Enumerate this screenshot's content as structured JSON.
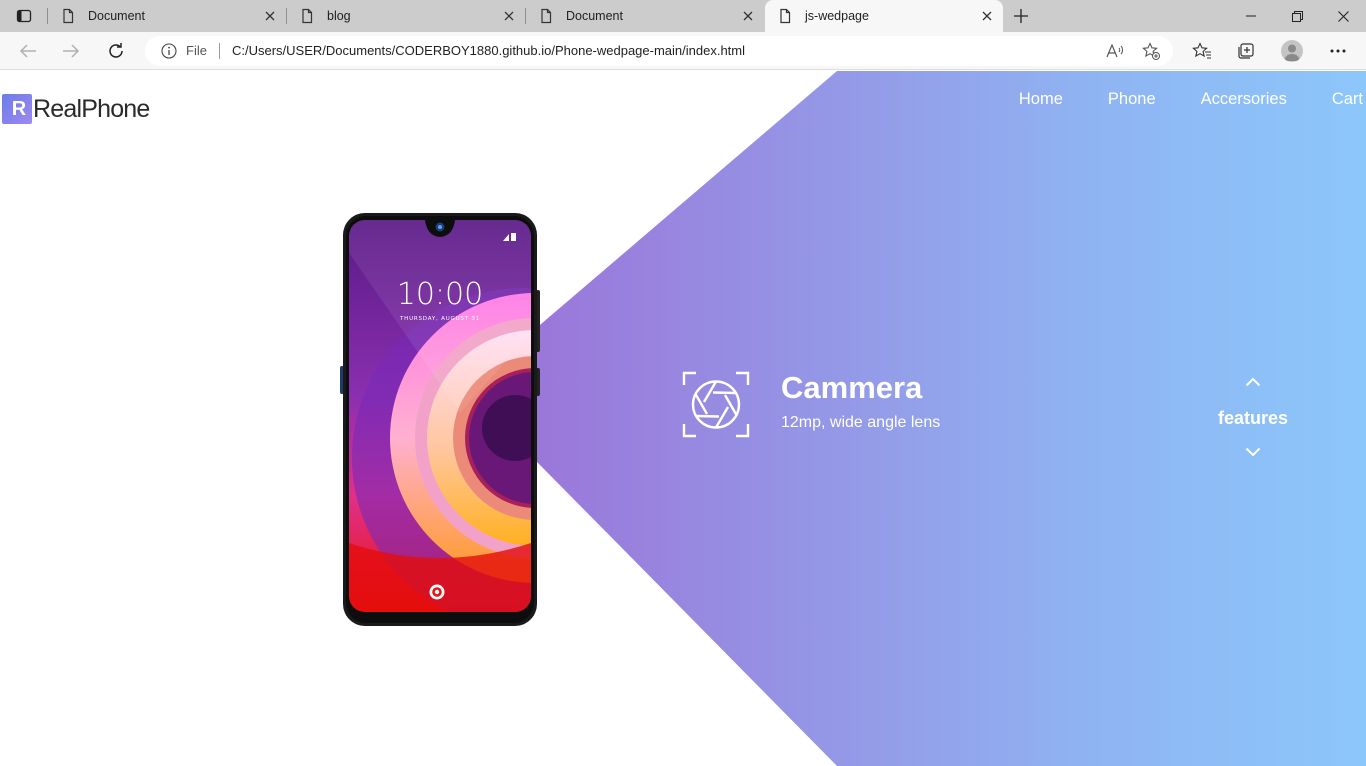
{
  "browser": {
    "tabs": [
      {
        "title": "Document",
        "active": false
      },
      {
        "title": "blog",
        "active": false
      },
      {
        "title": "Document",
        "active": false
      },
      {
        "title": "js-wedpage",
        "active": true
      }
    ],
    "address": {
      "scheme": "File",
      "url": "C:/Users/USER/Documents/CODERBOY1880.github.io/Phone-wedpage-main/index.html"
    },
    "icons": [
      "tab-actions-icon",
      "document-icon",
      "close-icon",
      "plus-icon",
      "minimize-icon",
      "restore-icon",
      "back-arrow-icon",
      "forward-arrow-icon",
      "refresh-icon",
      "info-icon",
      "read-aloud-icon",
      "add-favorite-icon",
      "favorites-icon",
      "collections-icon",
      "profile-icon",
      "more-icon"
    ]
  },
  "site": {
    "logo": {
      "mark": "R",
      "text": "RealPhone"
    },
    "nav": [
      "Home",
      "Phone",
      "Accersories",
      "Cart"
    ],
    "phone": {
      "time": "10:00",
      "date": "THURSDAY, AUGUST 31"
    },
    "feature": {
      "title": "Cammera",
      "description": "12mp, wide angle lens"
    },
    "features_nav": {
      "label": "features"
    },
    "colors": {
      "gradient_start": "#9a6fd6",
      "gradient_end": "#8cc7fb",
      "text_on_gradient": "#ffffff"
    }
  }
}
